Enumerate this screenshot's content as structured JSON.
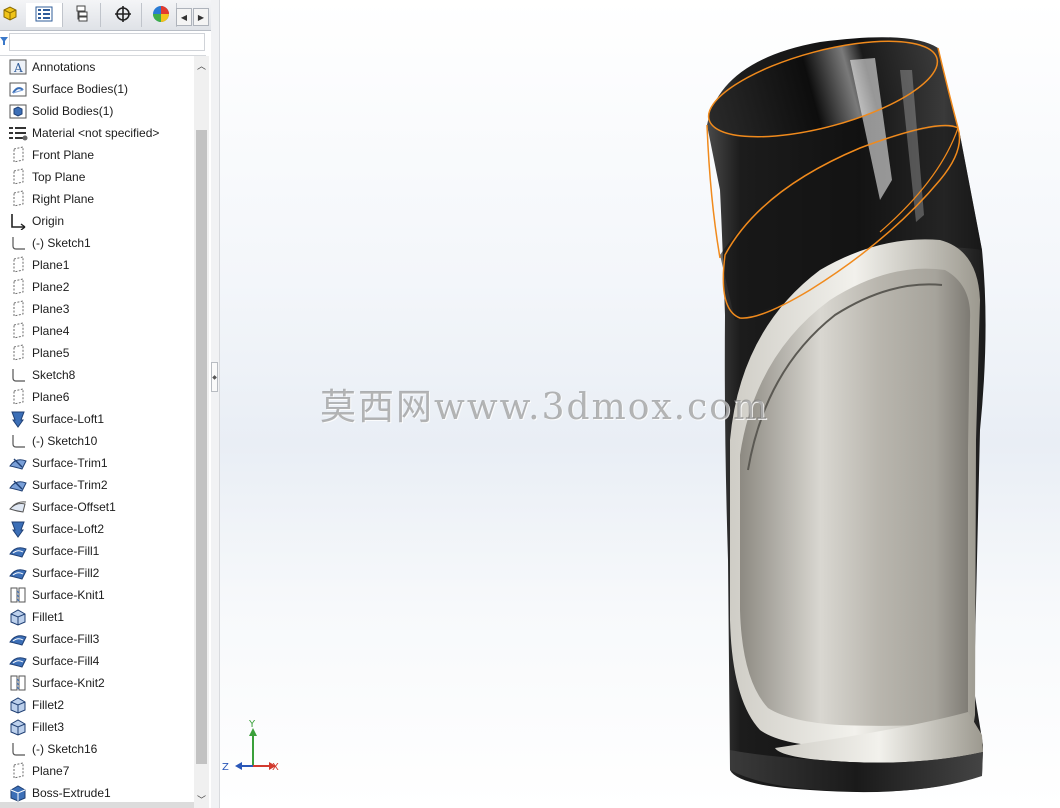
{
  "tabs": [
    {
      "name": "feature-manager",
      "icon": "feature-tree-icon"
    },
    {
      "name": "property-manager",
      "icon": "property-list-icon"
    },
    {
      "name": "configuration-manager",
      "icon": "configuration-icon"
    },
    {
      "name": "dimxpert-manager",
      "icon": "crosshair-icon"
    },
    {
      "name": "display-manager",
      "icon": "appearance-pie-icon"
    }
  ],
  "filter": {
    "placeholder": ""
  },
  "tree": [
    {
      "label": "Annotations",
      "icon": "annotations-icon"
    },
    {
      "label": "Surface Bodies(1)",
      "icon": "surface-bodies-folder-icon"
    },
    {
      "label": "Solid Bodies(1)",
      "icon": "solid-bodies-folder-icon"
    },
    {
      "label": "Material <not specified>",
      "icon": "material-icon"
    },
    {
      "label": "Front Plane",
      "icon": "plane-icon"
    },
    {
      "label": "Top Plane",
      "icon": "plane-icon"
    },
    {
      "label": "Right Plane",
      "icon": "plane-icon"
    },
    {
      "label": "Origin",
      "icon": "origin-icon"
    },
    {
      "label": "(-) Sketch1",
      "icon": "sketch-icon"
    },
    {
      "label": "Plane1",
      "icon": "plane-icon"
    },
    {
      "label": "Plane2",
      "icon": "plane-icon"
    },
    {
      "label": "Plane3",
      "icon": "plane-icon"
    },
    {
      "label": "Plane4",
      "icon": "plane-icon"
    },
    {
      "label": "Plane5",
      "icon": "plane-icon"
    },
    {
      "label": "Sketch8",
      "icon": "sketch-icon"
    },
    {
      "label": "Plane6",
      "icon": "plane-icon"
    },
    {
      "label": "Surface-Loft1",
      "icon": "loft-icon"
    },
    {
      "label": "(-) Sketch10",
      "icon": "sketch-icon"
    },
    {
      "label": "Surface-Trim1",
      "icon": "surface-trim-icon"
    },
    {
      "label": "Surface-Trim2",
      "icon": "surface-trim-icon"
    },
    {
      "label": "Surface-Offset1",
      "icon": "surface-offset-icon"
    },
    {
      "label": "Surface-Loft2",
      "icon": "loft-icon"
    },
    {
      "label": "Surface-Fill1",
      "icon": "surface-fill-icon"
    },
    {
      "label": "Surface-Fill2",
      "icon": "surface-fill-icon"
    },
    {
      "label": "Surface-Knit1",
      "icon": "surface-knit-icon"
    },
    {
      "label": "Fillet1",
      "icon": "fillet-icon"
    },
    {
      "label": "Surface-Fill3",
      "icon": "surface-fill-icon"
    },
    {
      "label": "Surface-Fill4",
      "icon": "surface-fill-icon"
    },
    {
      "label": "Surface-Knit2",
      "icon": "surface-knit-icon"
    },
    {
      "label": "Fillet2",
      "icon": "fillet-icon"
    },
    {
      "label": "Fillet3",
      "icon": "fillet-icon"
    },
    {
      "label": "(-) Sketch16",
      "icon": "sketch-icon"
    },
    {
      "label": "Plane7",
      "icon": "plane-icon"
    },
    {
      "label": "Boss-Extrude1",
      "icon": "boss-extrude-icon"
    }
  ],
  "viewport": {
    "watermark": "莫西网www.3dmox.com",
    "triad": {
      "x": "X",
      "y": "Y",
      "z": "Z"
    }
  },
  "colors": {
    "selection_edge": "#f08a1c",
    "body_dark": "#1a1a1a",
    "insert_grey": "#b9b6ae",
    "plane_icon": "#6b6b6b",
    "feature_icon": "#3c6fb7"
  }
}
